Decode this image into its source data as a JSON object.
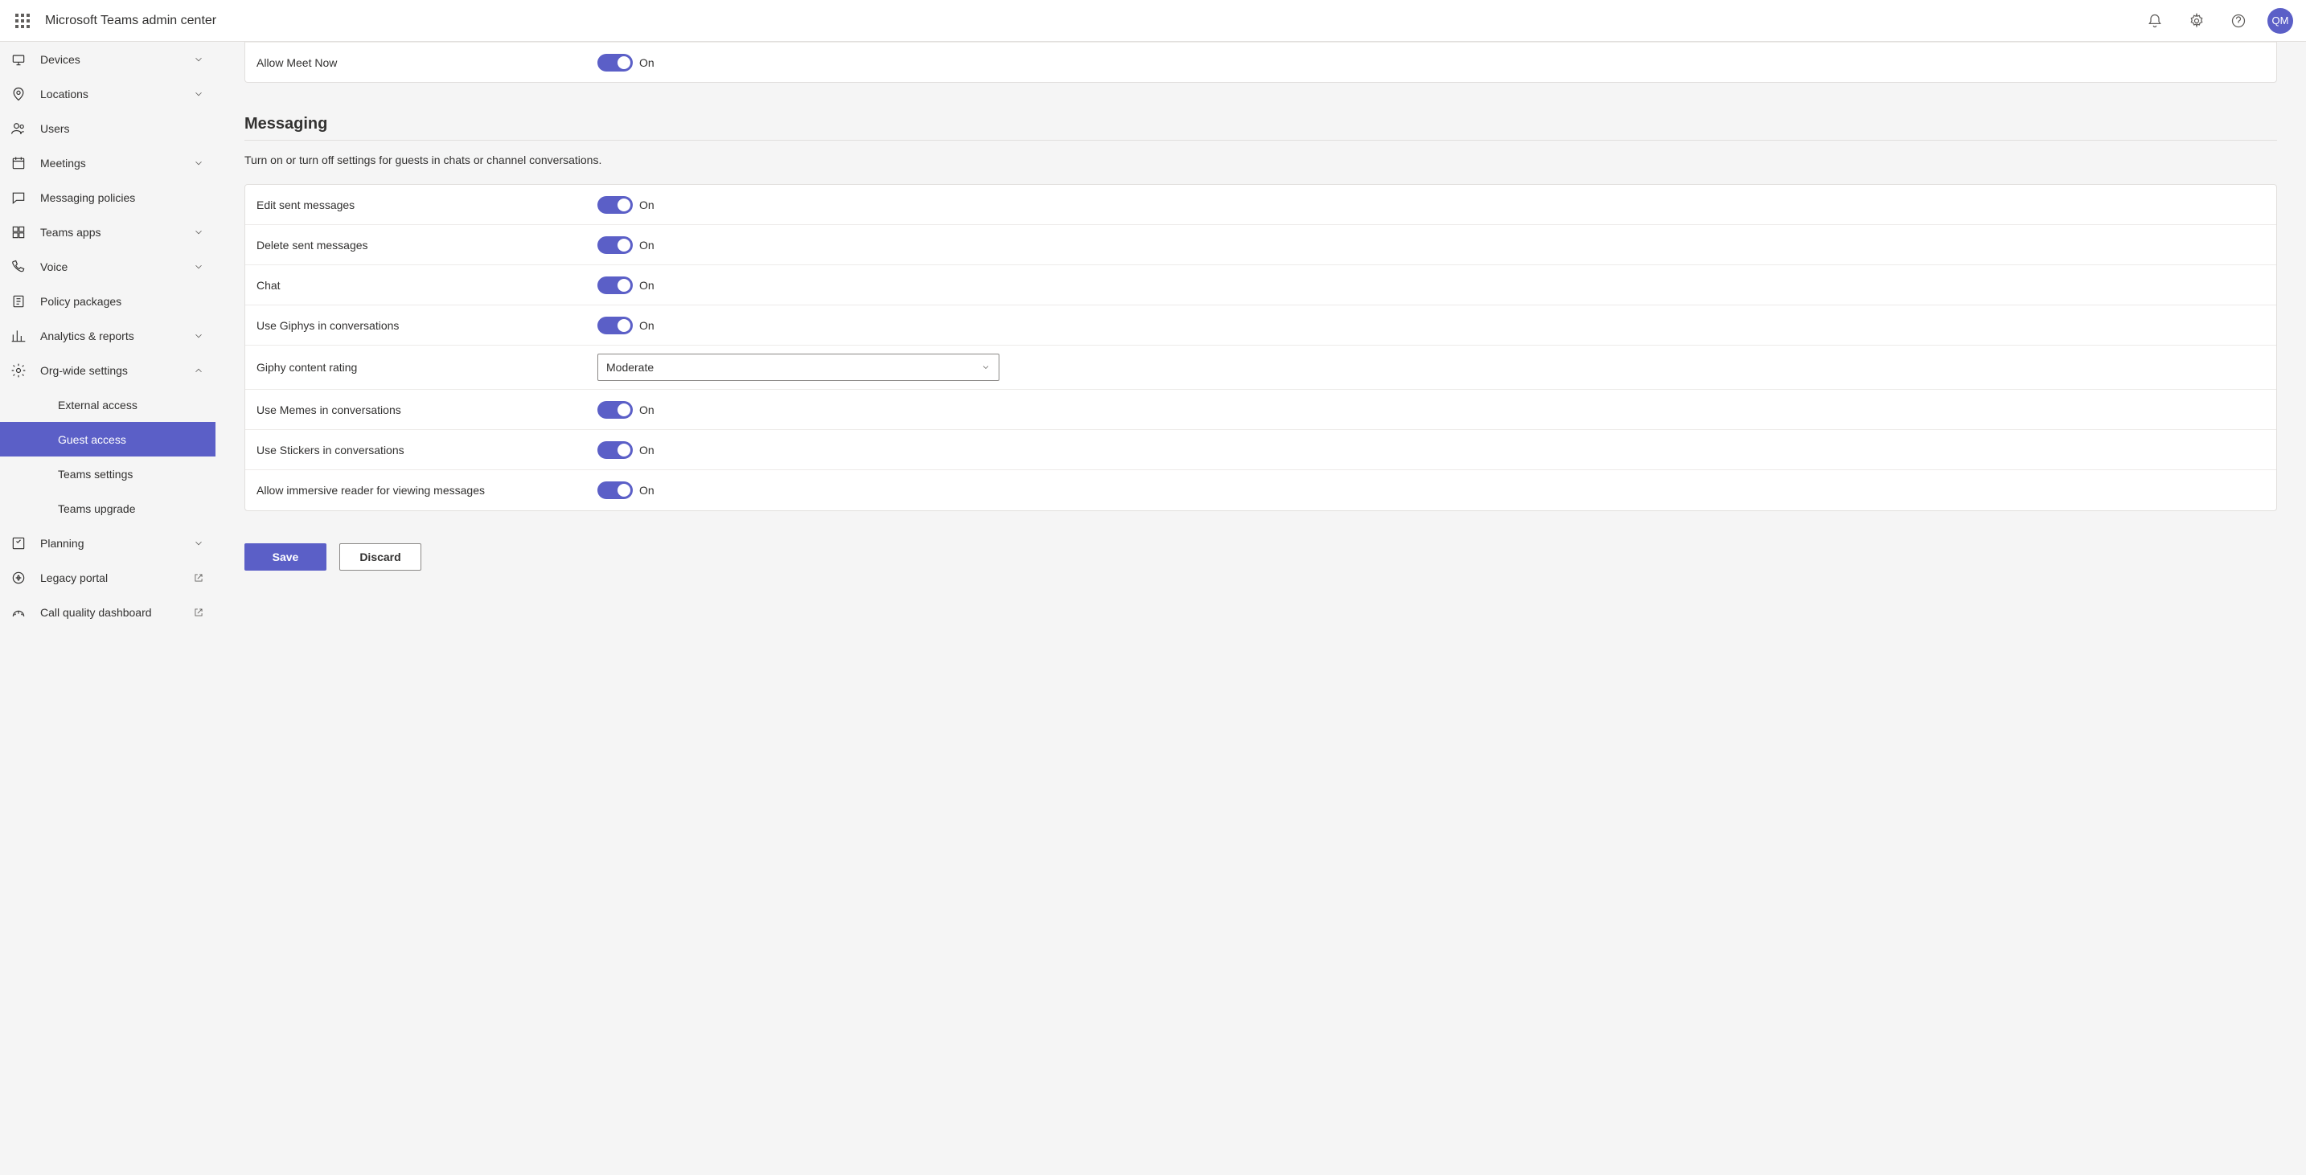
{
  "header": {
    "title": "Microsoft Teams admin center",
    "avatar_initials": "QM"
  },
  "sidebar": {
    "items": [
      {
        "label": "Devices",
        "expandable": true
      },
      {
        "label": "Locations",
        "expandable": true
      },
      {
        "label": "Users",
        "expandable": false
      },
      {
        "label": "Meetings",
        "expandable": true
      },
      {
        "label": "Messaging policies",
        "expandable": false
      },
      {
        "label": "Teams apps",
        "expandable": true
      },
      {
        "label": "Voice",
        "expandable": true
      },
      {
        "label": "Policy packages",
        "expandable": false
      },
      {
        "label": "Analytics & reports",
        "expandable": true
      },
      {
        "label": "Org-wide settings",
        "expandable": true,
        "expanded": true
      },
      {
        "label": "Planning",
        "expandable": true
      },
      {
        "label": "Legacy portal",
        "external": true
      },
      {
        "label": "Call quality dashboard",
        "external": true
      }
    ],
    "org_wide_children": [
      {
        "label": "External access"
      },
      {
        "label": "Guest access",
        "active": true
      },
      {
        "label": "Teams settings"
      },
      {
        "label": "Teams upgrade"
      }
    ]
  },
  "calling_card": {
    "rows": [
      {
        "label": "Allow Meet Now",
        "state": "On"
      }
    ]
  },
  "messaging_section": {
    "title": "Messaging",
    "description": "Turn on or turn off settings for guests in chats or channel conversations.",
    "rows": [
      {
        "label": "Edit sent messages",
        "state": "On",
        "type": "toggle"
      },
      {
        "label": "Delete sent messages",
        "state": "On",
        "type": "toggle"
      },
      {
        "label": "Chat",
        "state": "On",
        "type": "toggle"
      },
      {
        "label": "Use Giphys in conversations",
        "state": "On",
        "type": "toggle"
      },
      {
        "label": "Giphy content rating",
        "value": "Moderate",
        "type": "dropdown"
      },
      {
        "label": "Use Memes in conversations",
        "state": "On",
        "type": "toggle"
      },
      {
        "label": "Use Stickers in conversations",
        "state": "On",
        "type": "toggle"
      },
      {
        "label": "Allow immersive reader for viewing messages",
        "state": "On",
        "type": "toggle"
      }
    ]
  },
  "actions": {
    "save": "Save",
    "discard": "Discard"
  }
}
